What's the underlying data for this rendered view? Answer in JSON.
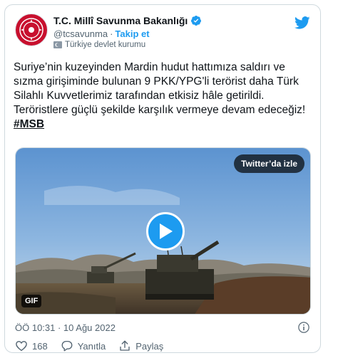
{
  "account": {
    "display_name": "T.C. Millî Savunma Bakanlığı",
    "handle": "@tcsavunma",
    "separator": "·",
    "follow_label": "Takip et",
    "label": "Türkiye devlet kurumu"
  },
  "tweet": {
    "text": "Suriye’nin kuzeyinden Mardin hudut hattımıza saldırı ve sızma girişiminde bulunan 9 PKK/YPG'li terörist daha Türk Silahlı Kuvvetlerimiz tarafından etkisiz hâle getirildi. Teröristlere güçlü şekilde karşılık vermeye devam edeceğiz!",
    "hashtag": "#MSB"
  },
  "media": {
    "watch_label": "Twitter’da izle",
    "gif_label": "GIF"
  },
  "timestamp": "ÖÖ 10:31 · 10 Ağu 2022",
  "actions": {
    "like_count": "168",
    "reply_label": "Yanıtla",
    "share_label": "Paylaş"
  },
  "colors": {
    "accent": "#1d9bf0",
    "brand_red": "#c8102e",
    "text_secondary": "#536471"
  },
  "icons": [
    "verified-badge-icon",
    "twitter-bird-icon",
    "flag-icon",
    "play-icon",
    "info-icon",
    "heart-icon",
    "reply-icon",
    "share-icon"
  ]
}
